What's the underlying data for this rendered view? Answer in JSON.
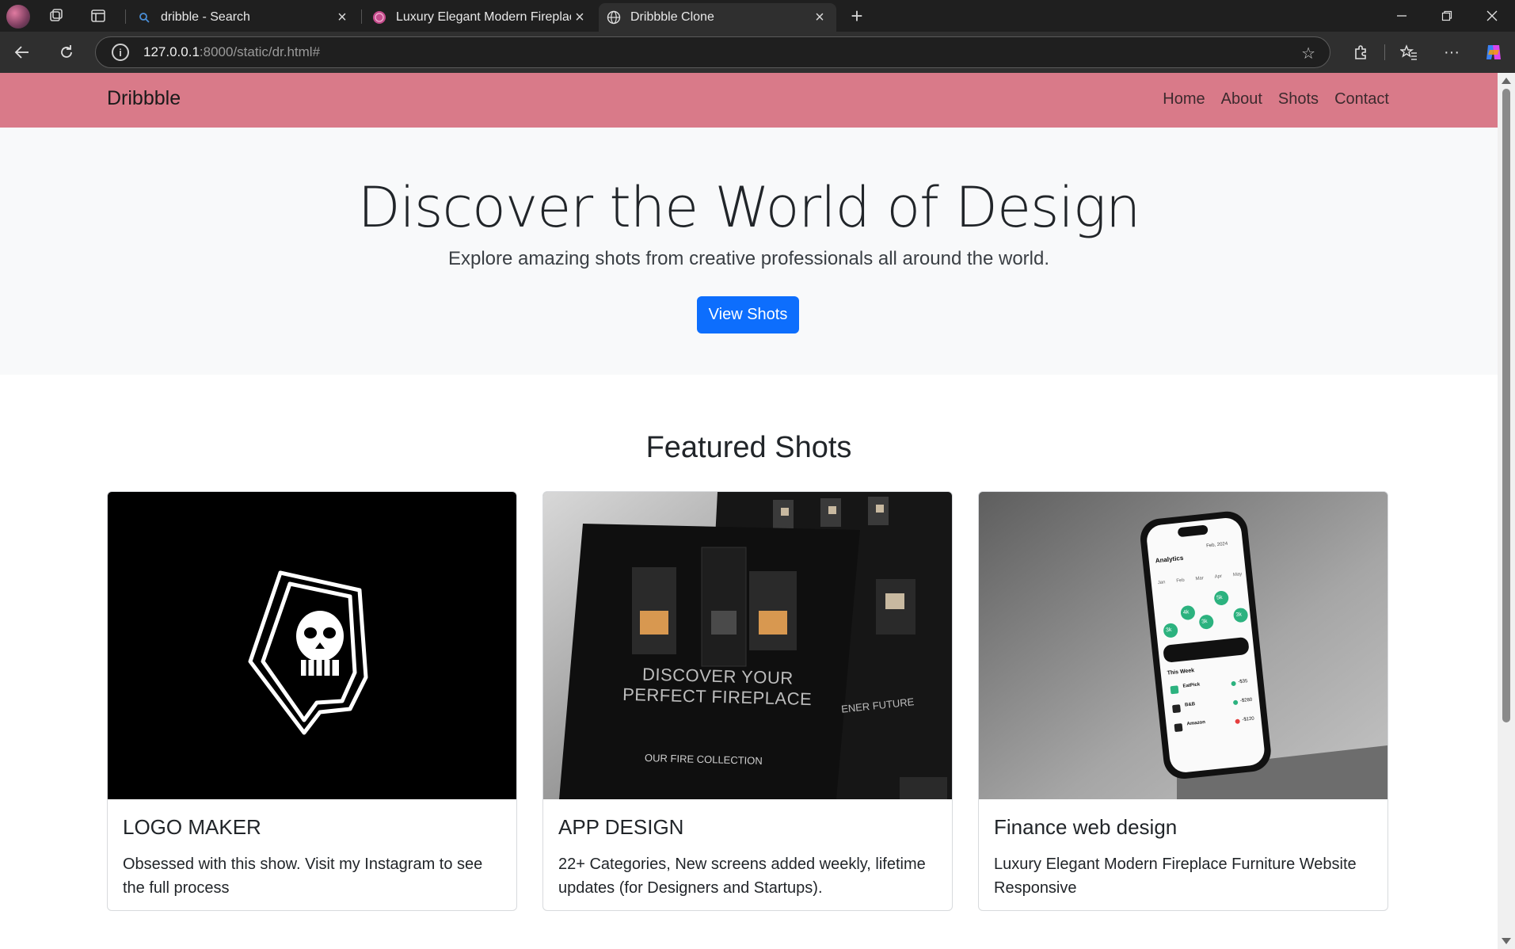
{
  "browser": {
    "tabs": [
      {
        "title": "dribble - Search",
        "icon": "search-icon"
      },
      {
        "title": "Luxury Elegant Modern Fireplace",
        "icon": "dribbble-icon"
      },
      {
        "title": "Dribbble Clone",
        "icon": "globe-icon",
        "active": true
      }
    ],
    "url_host": "127.0.0.1",
    "url_rest": ":8000/static/dr.html#"
  },
  "navbar": {
    "brand": "Dribbble",
    "links": [
      "Home",
      "About",
      "Shots",
      "Contact"
    ],
    "background": "#d97a89"
  },
  "hero": {
    "title": "Discover the World of Design",
    "subtitle": "Explore amazing shots from creative professionals all around the world.",
    "button": "View Shots",
    "button_color": "#0d6efd"
  },
  "featured": {
    "title": "Featured Shots",
    "cards": [
      {
        "title": "LOGO MAKER",
        "text": "Obsessed with this show. Visit my Instagram to see the full process"
      },
      {
        "title": "APP DESIGN",
        "text": "22+ Categories, New screens added weekly, lifetime updates (for Designers and Startups).",
        "image_text": {
          "headline1": "DISCOVER YOUR",
          "headline2": "PERFECT FIREPLACE",
          "collection": "OUR FIRE COLLECTION",
          "side": "ENER FUTURE"
        }
      },
      {
        "title": "Finance web design",
        "text": "Luxury Elegant Modern Fireplace Furniture Website Responsive",
        "image_text": {
          "analytics": "Analytics",
          "date": "Feb, 2024",
          "months": [
            "Jan",
            "Feb",
            "Mar",
            "Apr",
            "May"
          ],
          "bubbles": [
            "3k",
            "4k",
            "3k",
            "5k",
            "3k"
          ],
          "week": "This Week",
          "transactions": [
            {
              "name": "EatPick",
              "amount": "-$35"
            },
            {
              "name": "B&B",
              "amount": "-$280"
            },
            {
              "name": "Amazon",
              "amount": "-$120"
            }
          ]
        }
      }
    ]
  }
}
